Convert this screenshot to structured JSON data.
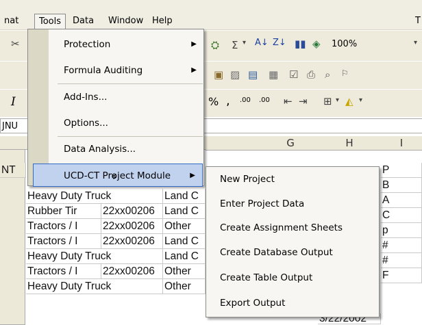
{
  "menubar": {
    "items": [
      {
        "label": "nat"
      },
      {
        "label": "Tools"
      },
      {
        "label": "Data"
      },
      {
        "label": "Window"
      },
      {
        "label": "Help"
      }
    ],
    "right_glyph": "T"
  },
  "toolbar": {
    "sigma": "Σ",
    "zoom": "100%",
    "italic": "I",
    "comma_style": ",",
    "increase_decimal": ".00",
    "decrease_decimal": ".00"
  },
  "namebox": {
    "value": "JNU"
  },
  "columns": [
    {
      "label": "G"
    },
    {
      "label": "H"
    },
    {
      "label": "I"
    }
  ],
  "rows": [
    {
      "d": "NT",
      "e": "",
      "f": "",
      "g": "",
      "h": "",
      "i": "P"
    },
    {
      "d": "",
      "e": "",
      "f": "",
      "g": "",
      "h": "",
      "i": "B"
    },
    {
      "d": "Heavy Duty Truck",
      "e": "",
      "f": "Land C",
      "g": "",
      "h": "",
      "i": "A"
    },
    {
      "d": "Rubber Tir",
      "e": "22xx00206",
      "f": "Land C",
      "g": "",
      "h": "",
      "i": "C"
    },
    {
      "d": "Tractors / I",
      "e": "22xx00206",
      "f": "Other",
      "g": "",
      "h": "",
      "i": "p"
    },
    {
      "d": "Tractors / I",
      "e": "22xx00206",
      "f": "Land C",
      "g": "",
      "h": "",
      "i": "#"
    },
    {
      "d": "Heavy Duty Truck",
      "e": "",
      "f": "Land C",
      "g": "",
      "h": "",
      "i": "#"
    },
    {
      "d": "Tractors / I",
      "e": "22xx00206",
      "f": "Other",
      "g": "",
      "h": "",
      "i": "F"
    },
    {
      "d": "Heavy Duty Truck",
      "e": "",
      "f": "Other",
      "g": "",
      "h": "3/22/2002",
      "i": ""
    }
  ],
  "tools_menu": {
    "items": [
      {
        "label": "Protection",
        "has_submenu": true
      },
      {
        "label": "Formula Auditing",
        "has_submenu": true
      },
      {
        "label": "Add-Ins...",
        "has_submenu": false
      },
      {
        "label": "Options...",
        "has_submenu": false
      },
      {
        "label": "Data Analysis...",
        "has_submenu": false
      },
      {
        "label": "UCD-CT Project Module",
        "has_submenu": true,
        "highlighted": true
      }
    ],
    "expand_glyph": "»"
  },
  "submenu": {
    "items": [
      {
        "label": "New Project"
      },
      {
        "label": "Enter Project Data"
      },
      {
        "label": "Create Assignment Sheets"
      },
      {
        "label": "Create Database Output"
      },
      {
        "label": "Create Table Output"
      },
      {
        "label": "Export Output"
      }
    ]
  },
  "colors": {
    "menu_highlight": "#c1d2ee",
    "menu_highlight_border": "#3169c6",
    "menubar_bg": "#f0ede2",
    "gutter": "#dcd8c6"
  }
}
